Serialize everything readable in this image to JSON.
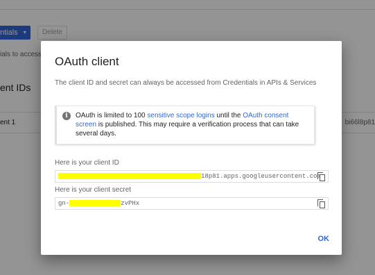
{
  "background": {
    "create_button_label": "ntials",
    "create_button_caret": "▾",
    "delete_button_label": "Delete",
    "access_text": "ials to access",
    "section_title": "ent IDs",
    "row_name": "ent 1",
    "row_id": "bi66l8p81"
  },
  "dialog": {
    "title": "OAuth client",
    "description": "The client ID and secret can always be accessed from Credentials in APIs & Services",
    "info": {
      "icon": "info-icon",
      "part1": "OAuth is limited to 100 ",
      "link1": "sensitive scope logins",
      "part2": " until the ",
      "link2": "OAuth consent screen",
      "part3": " is published. This may require a verification process that can take several days."
    },
    "client_id_label": "Here is your client ID",
    "client_id_value_suffix": "18p81.apps.googleusercontent.com",
    "client_secret_label": "Here is your client secret",
    "client_secret_prefix": "gn-",
    "client_secret_suffix": "zvPHx",
    "ok_label": "OK"
  }
}
